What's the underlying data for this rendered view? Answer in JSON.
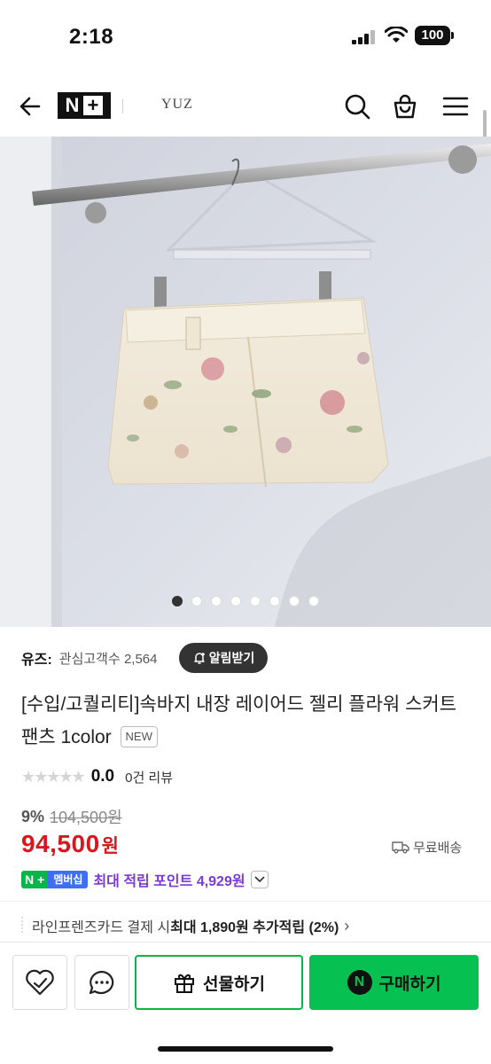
{
  "status_bar": {
    "time": "2:18",
    "battery": "100"
  },
  "nav": {
    "logo_n": "N",
    "logo_plus": "+",
    "store_name": "YUZ"
  },
  "carousel": {
    "total": 8,
    "active_index": 0
  },
  "store": {
    "label": "유즈:",
    "interest": "관심고객수 2,564",
    "notify_label": "알림받기"
  },
  "product": {
    "title": "[수입/고퀄리티]속바지 내장 레이어드 젤리 플라워 스커트 팬츠 1color",
    "badge": "NEW",
    "stars": "★★★★★",
    "rating": "0.0",
    "reviews": "0건 리뷰",
    "discount_rate": "9%",
    "original_price": "104,500원",
    "price": "94,500",
    "price_unit": "원",
    "shipping": "무료배송"
  },
  "membership": {
    "badge_n": "N",
    "badge_plus": "+",
    "badge_text": "멤버십",
    "points_text": "최대 적립 포인트 4,929원"
  },
  "card_offer": {
    "prefix": "라인프렌즈카드 결제 시 ",
    "strong": "최대 1,890원 추가적립 (2%)",
    "chevron": "›"
  },
  "bottom_bar": {
    "gift_label": "선물하기",
    "buy_label": "구매하기",
    "buy_icon": "N"
  },
  "colors": {
    "accent_green": "#07c052",
    "price_red": "#d8161f",
    "points_purple": "#7b39d9"
  }
}
